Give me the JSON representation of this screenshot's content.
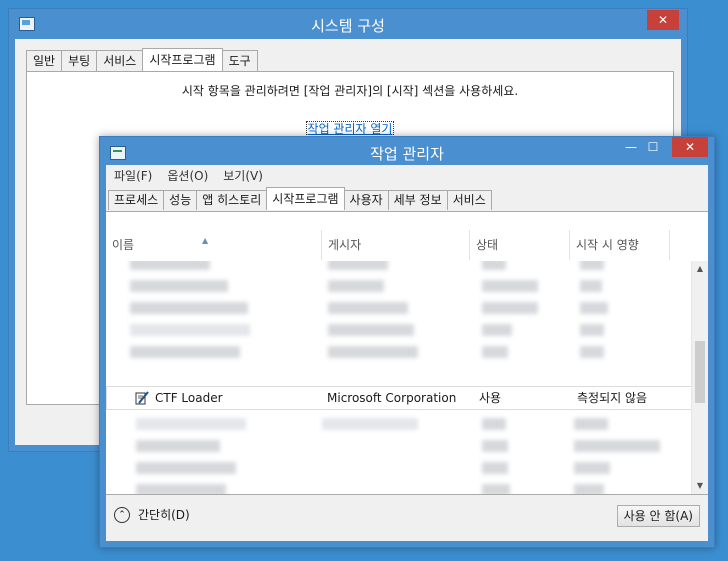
{
  "system_config": {
    "title": "시스템 구성",
    "close_glyph": "✕",
    "tabs": [
      "일반",
      "부팅",
      "서비스",
      "시작프로그램",
      "도구"
    ],
    "active_tab": 3,
    "message": "시작 항목을 관리하려면 [작업 관리자]의 [시작] 섹션을 사용하세요.",
    "link_text": "작업 관리자 열기"
  },
  "task_manager": {
    "title": "작업 관리자",
    "buttons": {
      "minimize": "—",
      "maximize": "☐",
      "close": "✕"
    },
    "menu": [
      "파일(F)",
      "옵션(O)",
      "보기(V)"
    ],
    "tabs": [
      "프로세스",
      "성능",
      "앱 히스토리",
      "시작프로그램",
      "사용자",
      "세부 정보",
      "서비스"
    ],
    "active_tab": 3,
    "columns": [
      "이름",
      "게시자",
      "상태",
      "시작 시 영향"
    ],
    "sort_glyph": "▲",
    "selected_row": {
      "name": "CTF Loader",
      "publisher": "Microsoft Corporation",
      "status": "사용",
      "impact": "측정되지 않음"
    },
    "scroll_up_glyph": "▲",
    "scroll_down_glyph": "▼",
    "fewer_details_glyph": "⌃",
    "fewer_details": "간단히(D)",
    "disable_button": "사용 안 함(A)"
  }
}
